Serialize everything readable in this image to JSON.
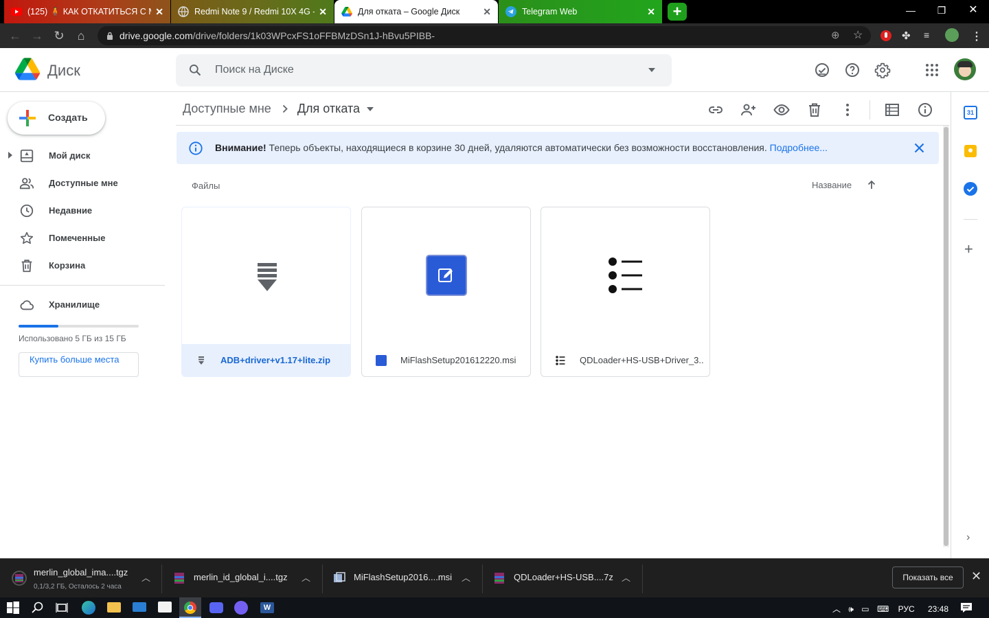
{
  "browser": {
    "tabs": [
      {
        "title": "(125) 🧍 КАК ОТКАТИТЬСЯ С MI",
        "icon": "youtube-icon"
      },
      {
        "title": "Redmi Note 9 / Redmi 10X 4G - (",
        "icon": "globe-icon"
      },
      {
        "title": "Для отката – Google Диск",
        "icon": "google-drive-icon"
      },
      {
        "title": "Telegram Web",
        "icon": "telegram-icon"
      }
    ],
    "url_host": "drive.google.com",
    "url_path": "/drive/folders/1k03WPcxFS1oFFBMzDSn1J-hBvu5PIBB-"
  },
  "drive": {
    "app_name": "Диск",
    "search_placeholder": "Поиск на Диске",
    "create_label": "Создать",
    "nav": [
      {
        "label": "Мой диск",
        "icon": "my-drive-icon"
      },
      {
        "label": "Доступные мне",
        "icon": "shared-icon"
      },
      {
        "label": "Недавние",
        "icon": "clock-icon"
      },
      {
        "label": "Помеченные",
        "icon": "star-icon"
      },
      {
        "label": "Корзина",
        "icon": "trash-icon"
      }
    ],
    "storage_label": "Хранилище",
    "storage_used_text": "Использовано 5 ГБ из 15 ГБ",
    "storage_fraction": 0.333,
    "buy_more": "Купить больше места",
    "breadcrumb_parent": "Доступные мне",
    "breadcrumb_current": "Для отката",
    "banner_bold": "Внимание!",
    "banner_text": "Теперь объекты, находящиеся в корзине 30 дней, удаляются автоматически без возможности восстановления.",
    "banner_link": "Подробнее...",
    "files_label": "Файлы",
    "sort_label": "Название",
    "files": [
      {
        "name": "ADB+driver+v1.17+lite.zip",
        "selected": true
      },
      {
        "name": "MiFlashSetup201612220.msi",
        "selected": false
      },
      {
        "name": "QDLoader+HS-USB+Driver_3...",
        "selected": false
      }
    ]
  },
  "downloads": {
    "items": [
      {
        "name": "merlin_global_ima....tgz",
        "sub": "0,1/3,2 ГБ, Осталось 2 часа"
      },
      {
        "name": "merlin_id_global_i....tgz"
      },
      {
        "name": "MiFlashSetup2016....msi"
      },
      {
        "name": "QDLoader+HS-USB....7z"
      }
    ],
    "show_all": "Показать все"
  },
  "taskbar": {
    "lang": "РУС",
    "time": "23:48"
  },
  "colors": {
    "accent": "#1a73e8",
    "banner_bg": "#e8f0fe",
    "selected_bg": "#e8f0fe"
  }
}
